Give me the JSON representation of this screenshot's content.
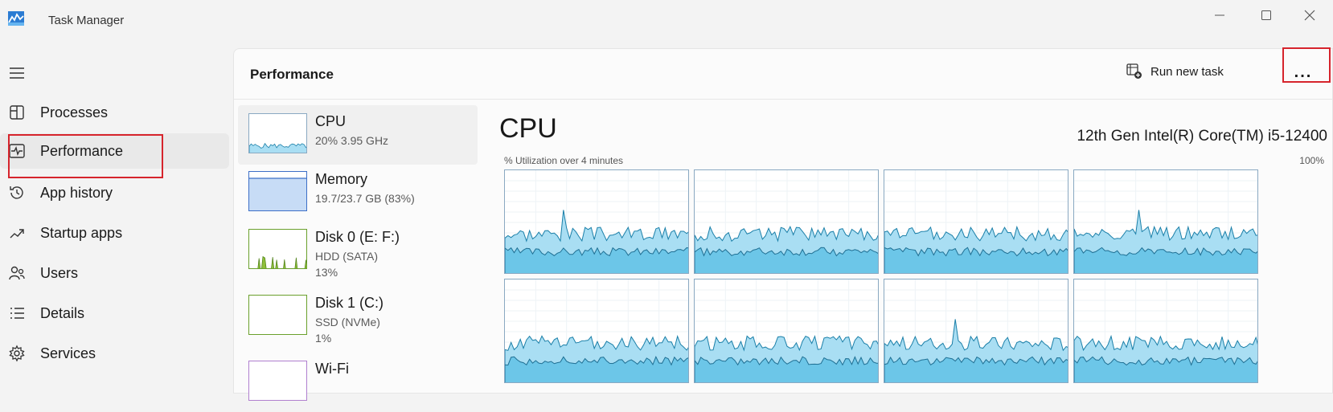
{
  "app": {
    "title": "Task Manager"
  },
  "window_controls": {
    "minimize": "minimize-icon",
    "maximize": "maximize-icon",
    "close": "close-icon"
  },
  "nav": {
    "items": [
      {
        "label": "Processes",
        "icon": "processes-icon"
      },
      {
        "label": "Performance",
        "icon": "performance-icon",
        "active": true
      },
      {
        "label": "App history",
        "icon": "history-icon"
      },
      {
        "label": "Startup apps",
        "icon": "startup-icon"
      },
      {
        "label": "Users",
        "icon": "users-icon"
      },
      {
        "label": "Details",
        "icon": "details-icon"
      },
      {
        "label": "Services",
        "icon": "services-icon"
      }
    ]
  },
  "header": {
    "title": "Performance",
    "run_new_task": "Run new task",
    "more": "..."
  },
  "resources": [
    {
      "name": "CPU",
      "line1": "20%  3.95 GHz",
      "line2": ""
    },
    {
      "name": "Memory",
      "line1": "19.7/23.7 GB (83%)",
      "line2": ""
    },
    {
      "name": "Disk 0 (E: F:)",
      "line1": "HDD (SATA)",
      "line2": "13%"
    },
    {
      "name": "Disk 1 (C:)",
      "line1": "SSD (NVMe)",
      "line2": "1%"
    },
    {
      "name": "Wi-Fi",
      "line1": "",
      "line2": ""
    }
  ],
  "detail": {
    "title": "CPU",
    "model": "12th Gen Intel(R) Core(TM) i5-12400",
    "util_label": "% Utilization over 4 minutes",
    "max_label": "100%"
  },
  "colors": {
    "accent": "#d6242c",
    "graph_line": "#1a7fa8",
    "graph_fill": "#a9def3",
    "graph_kernel": "#6cc6e8",
    "memory_fill": "#c7dcf6",
    "disk_fill": "#8fbf3b"
  }
}
